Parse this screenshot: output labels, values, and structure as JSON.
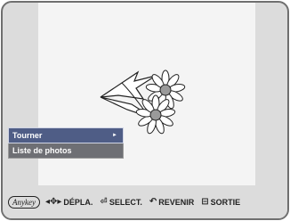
{
  "menu": {
    "items": [
      {
        "label": "Tourner",
        "selected": true,
        "has_submenu": true
      },
      {
        "label": "Liste de photos",
        "selected": false,
        "has_submenu": false
      }
    ],
    "submenu_arrow": "►"
  },
  "help_bar": {
    "anykey_label": "Anykey",
    "move": {
      "icon": "left-right-arrows-icon",
      "glyph": "◂✥▸",
      "label": "DÉPLA."
    },
    "select": {
      "icon": "enter-icon",
      "glyph": "⏎",
      "label": "SELECT."
    },
    "back": {
      "icon": "return-icon",
      "glyph": "↶",
      "label": "REVENIR"
    },
    "exit": {
      "icon": "exit-icon",
      "glyph": "⊟",
      "label": "SORTIE"
    }
  },
  "colors": {
    "background": "#dcdcdc",
    "photo_background": "#f4f4f4",
    "menu_selected": "#4f5d86",
    "menu_normal": "#6e6f74"
  }
}
